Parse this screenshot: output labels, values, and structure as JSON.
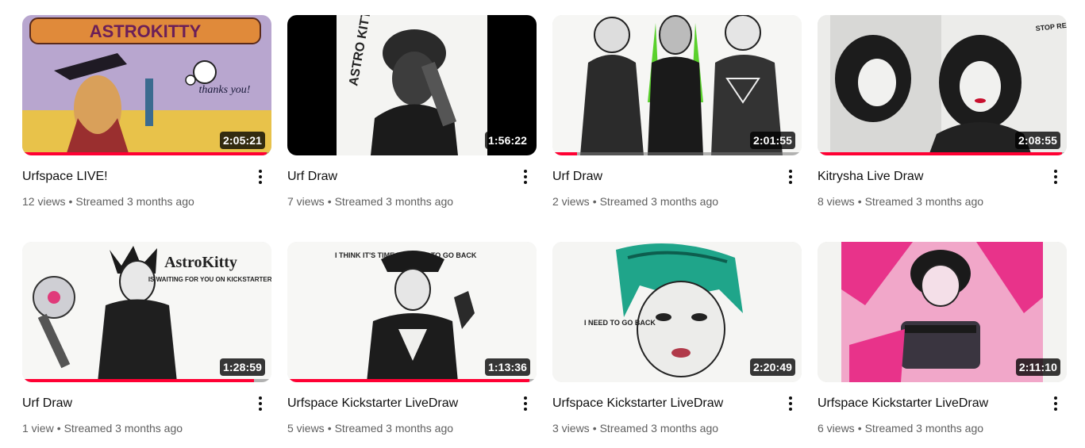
{
  "videos": [
    {
      "title": "Urfspace LIVE!",
      "views": "12 views",
      "streamed": "Streamed 3 months ago",
      "duration": "2:05:21",
      "progress": 0.98,
      "thumb_icon": "astrokitty-thanks-illustration"
    },
    {
      "title": "Urf Draw",
      "views": "7 views",
      "streamed": "Streamed 3 months ago",
      "duration": "1:56:22",
      "progress": 0,
      "thumb_icon": "portrait-drawing-pillarboxed"
    },
    {
      "title": "Urf Draw",
      "views": "2 views",
      "streamed": "Streamed 3 months ago",
      "duration": "2:01:55",
      "progress": 0.1,
      "thumb_icon": "three-figures-ink-drawing"
    },
    {
      "title": "Kitrysha Live Draw",
      "views": "8 views",
      "streamed": "Streamed 3 months ago",
      "duration": "2:08:55",
      "progress": 0.98,
      "thumb_icon": "twin-portrait-drawing"
    },
    {
      "title": "Urf Draw",
      "views": "1 view",
      "streamed": "Streamed 3 months ago",
      "duration": "1:28:59",
      "progress": 0.93,
      "thumb_icon": "punk-figure-drawing"
    },
    {
      "title": "Urfspace Kickstarter LiveDraw",
      "views": "5 views",
      "streamed": "Streamed 3 months ago",
      "duration": "1:13:36",
      "progress": 0.97,
      "thumb_icon": "officer-figure-drawing"
    },
    {
      "title": "Urfspace Kickstarter LiveDraw",
      "views": "3 views",
      "streamed": "Streamed 3 months ago",
      "duration": "2:20:49",
      "progress": 0,
      "thumb_icon": "green-hair-portrait-drawing"
    },
    {
      "title": "Urfspace Kickstarter LiveDraw",
      "views": "6 views",
      "streamed": "Streamed 3 months ago",
      "duration": "2:11:10",
      "progress": 0,
      "thumb_icon": "pink-portrait-drawing"
    }
  ],
  "colors": {
    "progress": "#ff0033",
    "meta": "#606060",
    "title": "#0f0f0f"
  },
  "thumb_art": {
    "t0_logo": "ASTROKITTY",
    "t0_thanks": "thanks you!",
    "t1_side": "ASTRO KITTY",
    "t3_note": "STOP REFLECTING GO BACK",
    "t4_logo": "AstroKitty",
    "t4_sub": "IS WAITING FOR YOU ON KICKSTARTER!",
    "t5_note": "I THINK IT'S TIME FOR YOU TO GO BACK",
    "t6_note": "I NEED TO GO BACK"
  }
}
